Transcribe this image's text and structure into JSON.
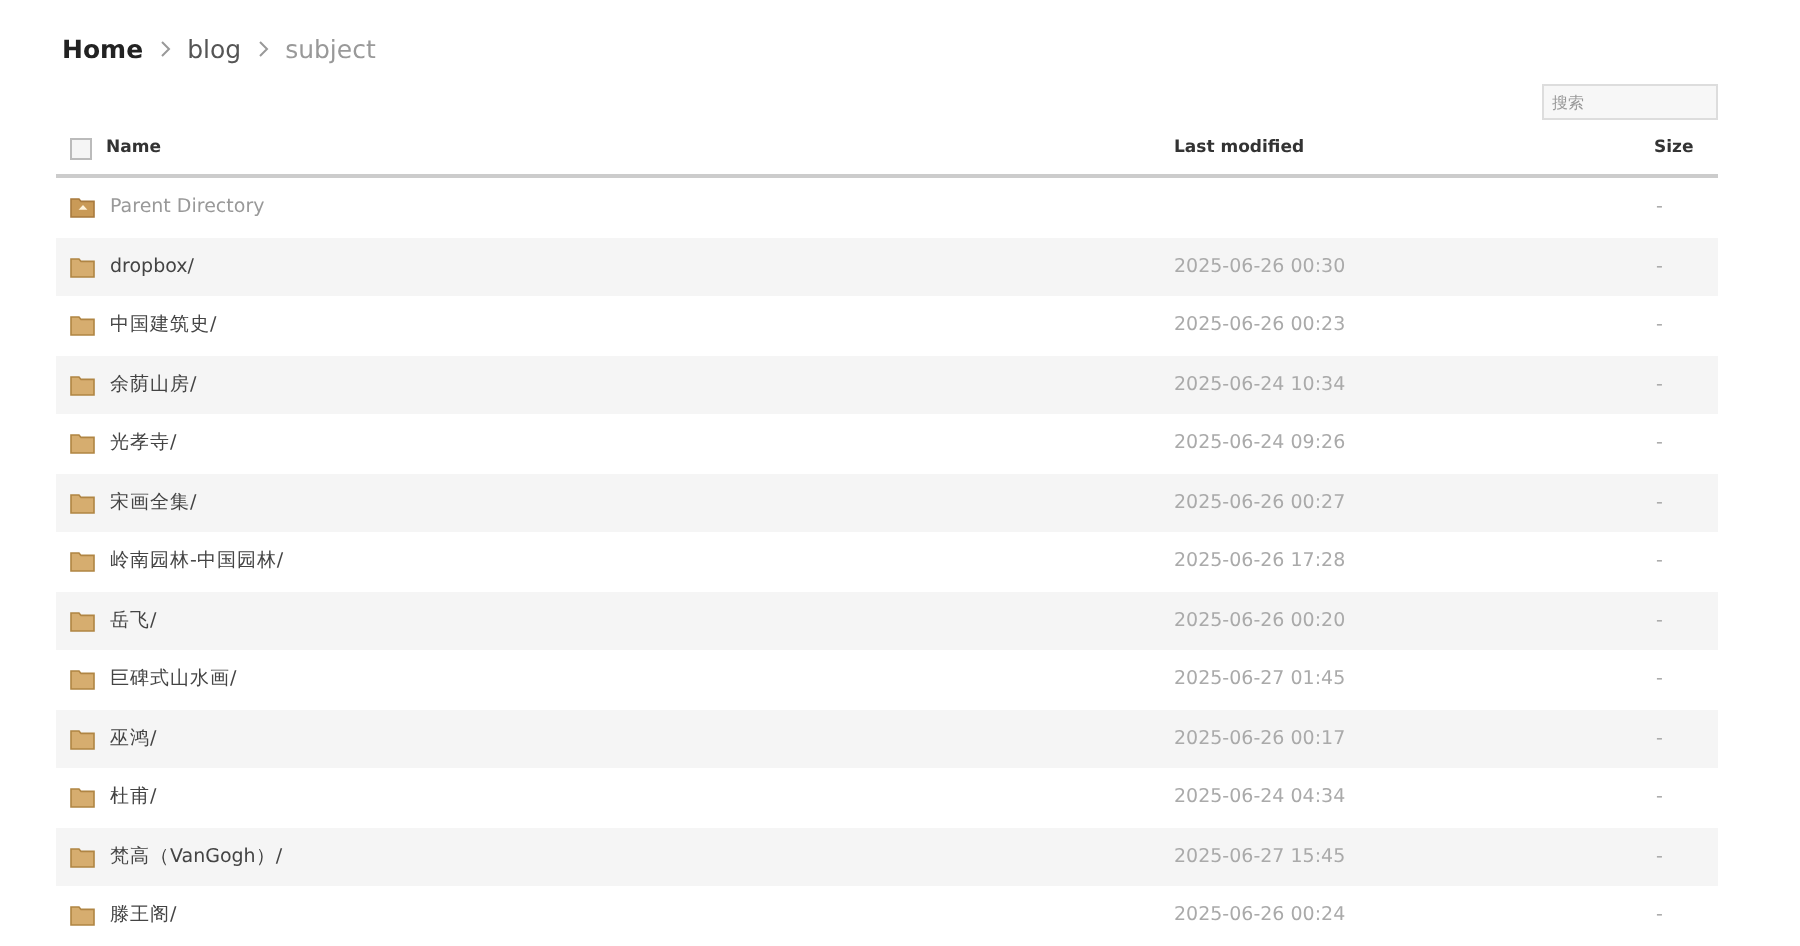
{
  "breadcrumb": [
    {
      "label": "Home",
      "kind": "home"
    },
    {
      "label": "blog",
      "kind": "link"
    },
    {
      "label": "subject",
      "kind": "current"
    }
  ],
  "search": {
    "placeholder": "搜索"
  },
  "table": {
    "select_all_checked": false,
    "columns": [
      "Name",
      "Last modified",
      "Size"
    ],
    "rows": [
      {
        "kind": "parent",
        "name": "Parent Directory",
        "modified": "",
        "size": "-"
      },
      {
        "kind": "folder",
        "name": "dropbox/",
        "modified": "2025-06-26 00:30",
        "size": "-"
      },
      {
        "kind": "folder",
        "name": "中国建筑史/",
        "modified": "2025-06-26 00:23",
        "size": "-"
      },
      {
        "kind": "folder",
        "name": "余荫山房/",
        "modified": "2025-06-24 10:34",
        "size": "-"
      },
      {
        "kind": "folder",
        "name": "光孝寺/",
        "modified": "2025-06-24 09:26",
        "size": "-"
      },
      {
        "kind": "folder",
        "name": "宋画全集/",
        "modified": "2025-06-26 00:27",
        "size": "-"
      },
      {
        "kind": "folder",
        "name": "岭南园林-中国园林/",
        "modified": "2025-06-26 17:28",
        "size": "-"
      },
      {
        "kind": "folder",
        "name": "岳飞/",
        "modified": "2025-06-26 00:20",
        "size": "-"
      },
      {
        "kind": "folder",
        "name": "巨碑式山水画/",
        "modified": "2025-06-27 01:45",
        "size": "-"
      },
      {
        "kind": "folder",
        "name": "巫鸿/",
        "modified": "2025-06-26 00:17",
        "size": "-"
      },
      {
        "kind": "folder",
        "name": "杜甫/",
        "modified": "2025-06-24 04:34",
        "size": "-"
      },
      {
        "kind": "folder",
        "name": "梵高（VanGogh）/",
        "modified": "2025-06-27 15:45",
        "size": "-"
      },
      {
        "kind": "folder",
        "name": "滕王阁/",
        "modified": "2025-06-26 00:24",
        "size": "-"
      }
    ]
  }
}
